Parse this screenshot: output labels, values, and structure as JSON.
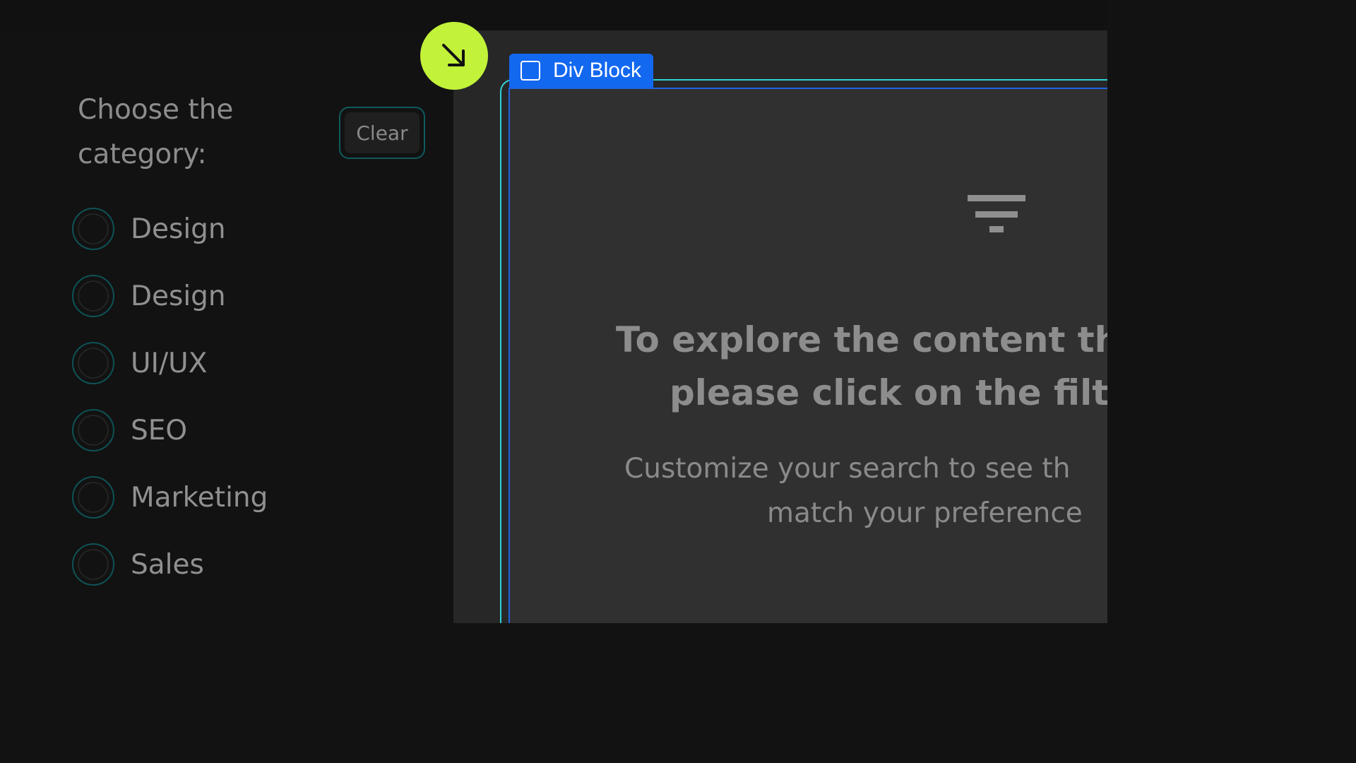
{
  "filter_panel": {
    "title": "Choose the category:",
    "clear_label": "Clear",
    "options": [
      {
        "label": "Design"
      },
      {
        "label": "Design"
      },
      {
        "label": "UI/UX"
      },
      {
        "label": "SEO"
      },
      {
        "label": "Marketing"
      },
      {
        "label": "Sales"
      }
    ]
  },
  "canvas": {
    "element_tag": "Div Block",
    "empty_state": {
      "icon": "filter-icon",
      "title_line1": "To explore the content tha",
      "title_line2": "please click on the filter",
      "subtitle_line1": "Customize your search to see th",
      "subtitle_line2": "match your preference"
    }
  },
  "badge": {
    "icon": "arrow-down-right-icon",
    "color": "#c2f23a"
  },
  "colors": {
    "selection_outline": "#2ed2d9",
    "tag_background": "#1368f0",
    "radio_border": "#0e5256"
  }
}
